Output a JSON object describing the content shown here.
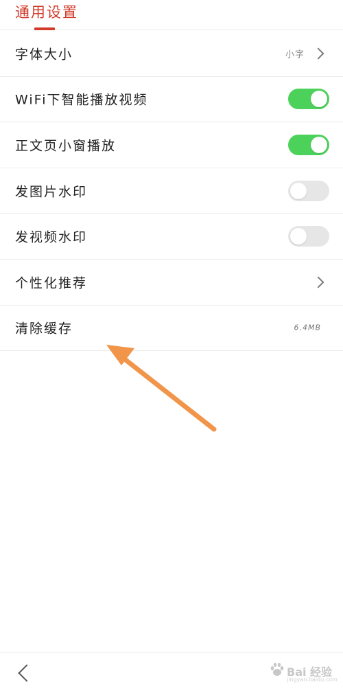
{
  "header": {
    "title": "通用设置"
  },
  "settings": [
    {
      "label": "字体大小",
      "value": "小字",
      "type": "chevron"
    },
    {
      "label": "WiFi下智能播放视频",
      "type": "toggle",
      "on": true
    },
    {
      "label": "正文页小窗播放",
      "type": "toggle",
      "on": true
    },
    {
      "label": "发图片水印",
      "type": "toggle",
      "on": false
    },
    {
      "label": "发视频水印",
      "type": "toggle",
      "on": false
    },
    {
      "label": "个性化推荐",
      "type": "chevron"
    },
    {
      "label": "清除缓存",
      "value": "6.4MB",
      "type": "value"
    }
  ],
  "colors": {
    "accent": "#d23b2a",
    "toggle_on": "#4cd25a",
    "toggle_off": "#e6e6e6",
    "arrow": "#f0954a"
  },
  "watermark": {
    "brand": "Bai 经验",
    "url": "jingyan.baidu.com"
  }
}
